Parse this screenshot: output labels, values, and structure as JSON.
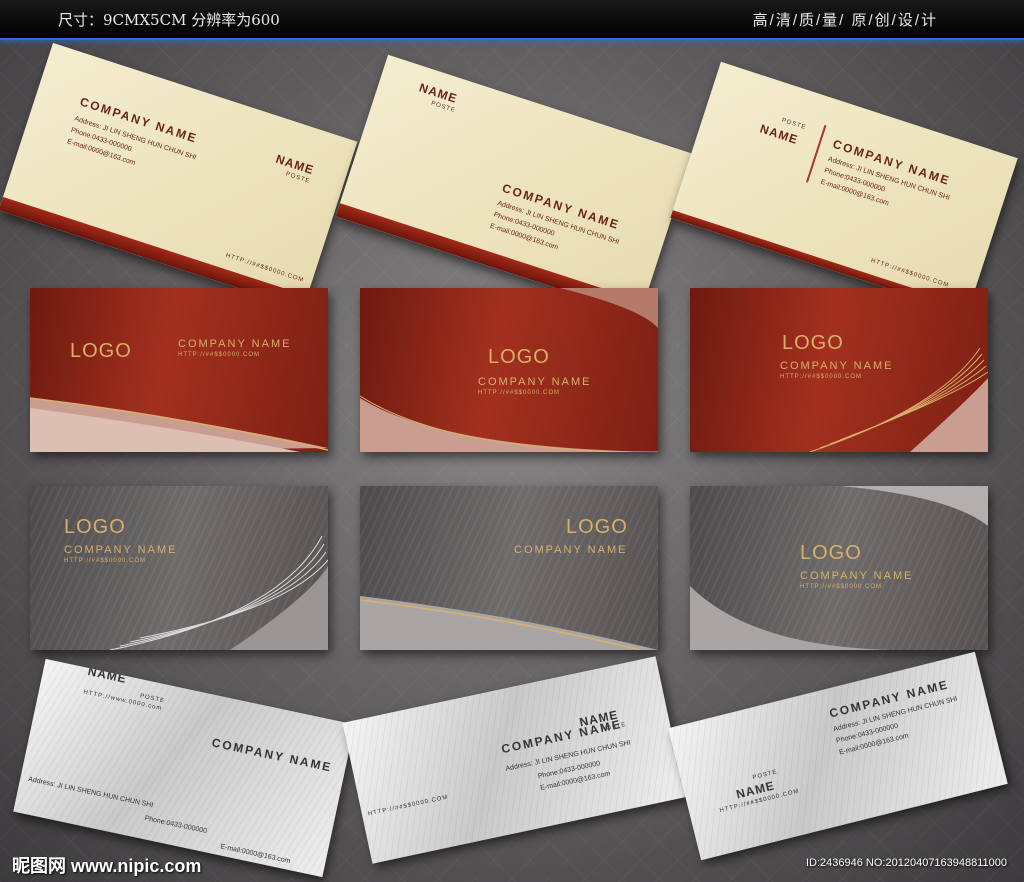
{
  "header": {
    "left": "尺寸：9CMX5CM 分辨率为600",
    "right": "高/清/质/量/ 原/创/设/计"
  },
  "cards": {
    "company": "COMPANY   NAME",
    "name": "NAME",
    "poste": "POSTE",
    "address": "Address:  JI LIN SHENG HUN CHUN SHI",
    "phone": "Phone:0433-000000",
    "email": "E-mail:0000@163.com",
    "logo": "LOGO",
    "url": "HTTP://##$$0000.COM",
    "url_www": "HTTP://www.0000.com"
  },
  "watermark": {
    "site": "昵图网 www.nipic.com",
    "id": "ID:2436946 NO:20120407163948811000"
  }
}
